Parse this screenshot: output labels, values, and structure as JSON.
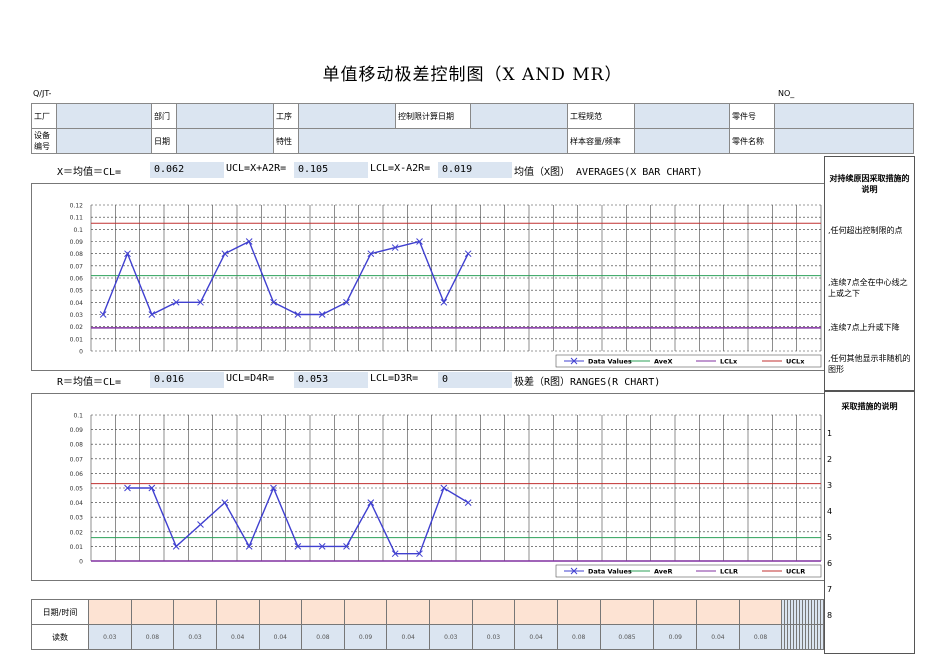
{
  "title": "单值移动极差控制图（X AND MR）",
  "doc_code": "Q/JT-",
  "doc_no": "NO_",
  "header": {
    "row1": [
      "工厂",
      "",
      "部门",
      "",
      "工序",
      "",
      "控制限计算日期",
      "",
      "工程规范",
      "",
      "零件号",
      ""
    ],
    "row2": [
      "设备编号",
      "",
      "日期",
      "",
      "特性",
      "",
      "",
      "",
      "样本容量/频率",
      "",
      "零件名称",
      ""
    ]
  },
  "x_stats": {
    "cl_label": "X＝均值＝CL=",
    "cl": "0.062",
    "ucl_label": "UCL=X+A2R=",
    "ucl": "0.105",
    "lcl_label": "LCL=X-A2R=",
    "lcl": "0.019",
    "chart_title": "均值（X图） AVERAGES(X BAR CHART)"
  },
  "r_stats": {
    "cl_label": "R＝均值＝CL=",
    "cl": "0.016",
    "ucl_label": "UCL=D4R=",
    "ucl": "0.053",
    "lcl_label": "LCL=D3R=",
    "lcl": "0",
    "chart_title": "极差（R图）RANGES(R CHART)"
  },
  "side_panel": {
    "top_heading": "对持续原因采取措施的说明",
    "notes": [
      ",任何超出控制限的点",
      ",连续7点全在中心线之上或之下",
      ",连续7点上升或下降",
      ",任何其他显示非随机的图形"
    ],
    "bottom_heading": "采取措施的说明",
    "numbers": [
      "1",
      "2",
      "3",
      "4",
      "5",
      "6",
      "7",
      "8"
    ]
  },
  "bottom": {
    "date_label": "日期/时间",
    "reading_label": "读数",
    "readings": [
      "0.03",
      "0.08",
      "0.03",
      "0.04",
      "0.04",
      "0.08",
      "0.09",
      "0.04",
      "0.03",
      "0.03",
      "0.04",
      "0.08",
      "0.085",
      "0.09",
      "0.04",
      "0.08"
    ]
  },
  "colors": {
    "series": "#4040d0",
    "ave": "#2ca05a",
    "lcl": "#8030a0",
    "ucl": "#c03030",
    "blue_cell": "#dbe5f1",
    "peach_cell": "#fde3d3"
  },
  "chart_data": [
    {
      "type": "line",
      "ylim": [
        0,
        0.12
      ],
      "yticks": [
        "0.12",
        "0.11",
        "0.1",
        "0.09",
        "0.08",
        "0.07",
        "0.06",
        "0.05",
        "0.04",
        "0.03",
        "0.02",
        "0.01",
        "0"
      ],
      "series": [
        {
          "name": "Data Values",
          "values": [
            0.03,
            0.08,
            0.03,
            0.04,
            0.04,
            0.08,
            0.09,
            0.04,
            0.03,
            0.03,
            0.04,
            0.08,
            0.085,
            0.09,
            0.04,
            0.08
          ]
        },
        {
          "name": "AveX",
          "constant": 0.062
        },
        {
          "name": "LCLx",
          "constant": 0.019
        },
        {
          "name": "UCLx",
          "constant": 0.105
        }
      ],
      "legend": [
        "Data Values",
        "AveX",
        "LCLx",
        "UCLx"
      ]
    },
    {
      "type": "line",
      "ylim": [
        0,
        0.1
      ],
      "yticks": [
        "0.1",
        "0.09",
        "0.08",
        "0.07",
        "0.06",
        "0.05",
        "0.04",
        "0.03",
        "0.02",
        "0.01",
        "0"
      ],
      "series": [
        {
          "name": "Data Values",
          "values": [
            null,
            0.05,
            0.05,
            0.01,
            0.025,
            0.04,
            0.01,
            0.05,
            0.01,
            0.01,
            0.01,
            0.04,
            0.005,
            0.005,
            0.05,
            0.04
          ]
        },
        {
          "name": "AveR",
          "constant": 0.016
        },
        {
          "name": "LCLR",
          "constant": 0
        },
        {
          "name": "UCLR",
          "constant": 0.053
        }
      ],
      "legend": [
        "Data Values",
        "AveR",
        "LCLR",
        "UCLR"
      ]
    }
  ]
}
